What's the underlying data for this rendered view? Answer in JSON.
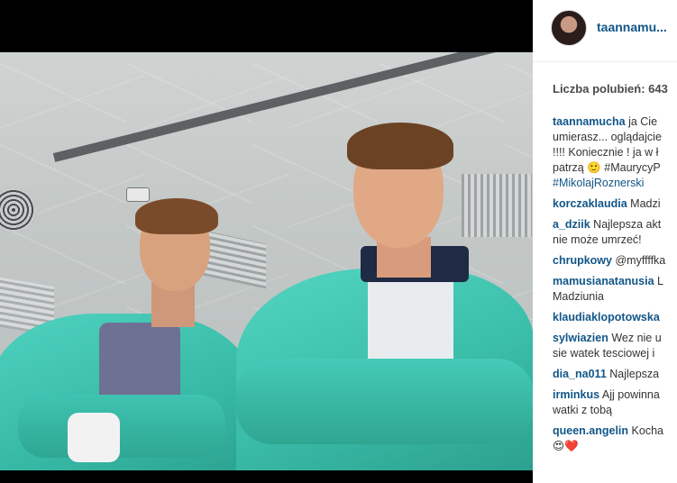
{
  "post": {
    "username": "taannamu...",
    "likes_text": "Liczba polubień: 643"
  },
  "comments": [
    {
      "user": "taannamucha",
      "lines": [
        "ja Cie",
        "umierasz... oglądajcie",
        "!!!! Koniecznie ! ja w ł",
        "patrzą 🙂 #MaurycyP",
        "#MikolajRoznerski"
      ]
    },
    {
      "user": "korczaklaudia",
      "lines": [
        "Madzi"
      ]
    },
    {
      "user": "a_dziik",
      "lines": [
        "Najlepsza akt",
        "nie może umrzeć!"
      ]
    },
    {
      "user": "chrupkowy",
      "lines": [
        "@myffffka"
      ]
    },
    {
      "user": "mamusianatanusia",
      "lines": [
        "L",
        "Madziunia"
      ]
    },
    {
      "user": "klaudiaklopotowska",
      "lines": [
        ""
      ]
    },
    {
      "user": "sylwiazien",
      "lines": [
        "Wez nie u",
        "sie watek tesciowej i"
      ]
    },
    {
      "user": "dia_na011",
      "lines": [
        "Najlepsza"
      ]
    },
    {
      "user": "irminkus",
      "lines": [
        "Ajj powinna",
        "watki z tobą"
      ]
    },
    {
      "user": "queen.angelin",
      "lines": [
        "Kocha",
        "😍❤️"
      ]
    }
  ]
}
